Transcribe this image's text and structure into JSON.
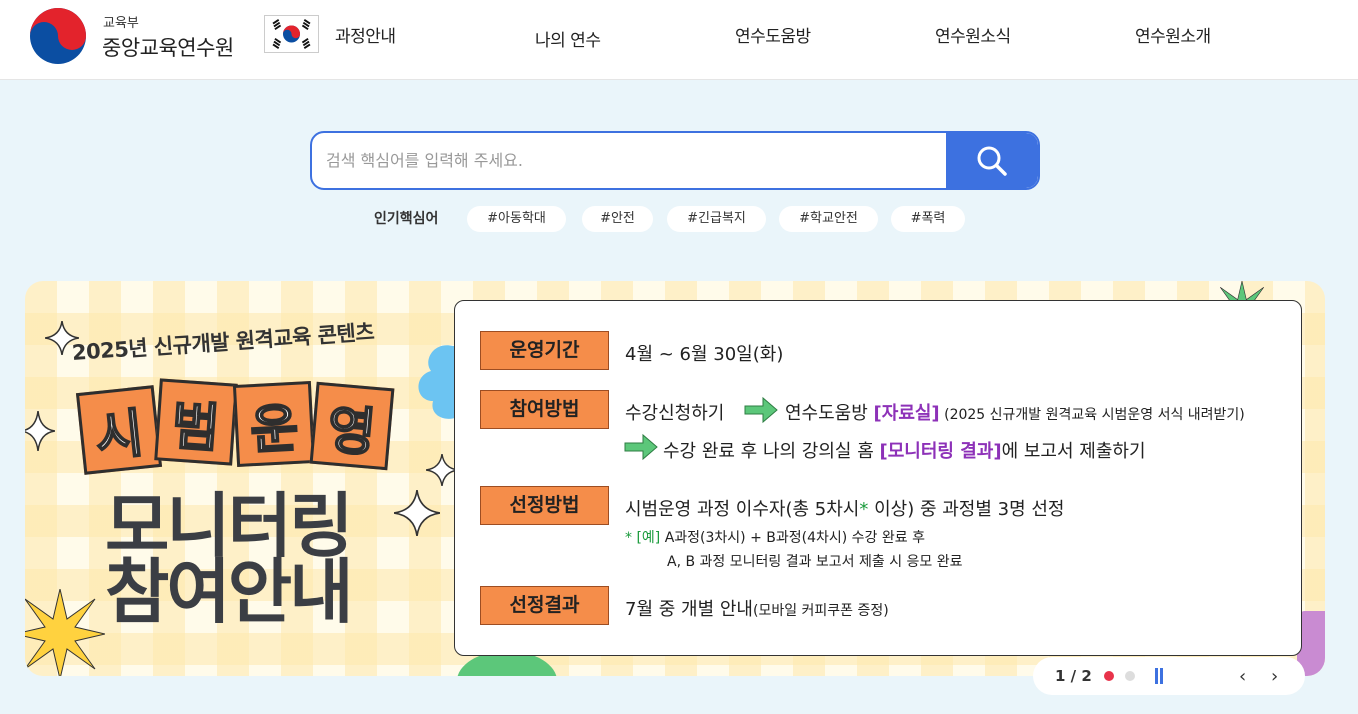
{
  "header": {
    "logo_sub": "교육부",
    "logo_main": "중앙교육연수원",
    "nav": [
      "과정안내",
      "나의 연수",
      "연수도움방",
      "연수원소식",
      "연수원소개"
    ]
  },
  "search": {
    "placeholder": "검색 핵심어를 입력해 주세요.",
    "popular_label": "인기핵심어",
    "tags": [
      "#아동학대",
      "#안전",
      "#긴급복지",
      "#학교안전",
      "#폭력"
    ]
  },
  "banner": {
    "subtitle": "2025년 신규개발 원격교육 콘텐츠",
    "tiles": [
      "시",
      "범",
      "운",
      "영"
    ],
    "title_line1": "모니터링",
    "title_line2": "참여안내",
    "rows": {
      "period_label": "운영기간",
      "period_text": "4월 ~ 6월 30일(화)",
      "method_label": "참여방법",
      "method_a": "수강신청하기",
      "method_b1": "연수도움방 ",
      "method_b2": "[자료실]",
      "method_b3": " (2025 신규개발 원격교육 시범운영 서식 내려받기)",
      "method_c1": "수강 완료 후 나의 강의실 홈 ",
      "method_c2": "[모니터링 결과]",
      "method_c3": "에 보고서 제출하기",
      "select_label": "선정방법",
      "select_text1": "시범운영 과정 이수자(총 5차시",
      "select_star": "*",
      "select_text2": " 이상) 중 과정별 3명 선정",
      "note_prefix": "* [예]",
      "note_line1": " A과정(3차시) + B과정(4차시) 수강 완료 후",
      "note_line2": "A, B 과정 모니터링 결과 보고서 제출 시 응모 완료",
      "result_label": "선정결과",
      "result_text1": "7월 중 개별 안내",
      "result_text2": "(모바일 커피쿠폰 증정)"
    }
  },
  "pager": {
    "count": "1 / 2",
    "prev": "‹",
    "next": "›"
  },
  "colors": {
    "accent": "#3d71e0",
    "orange": "#f58d4a",
    "purple": "#8d31b8",
    "dot_active": "#e8334a"
  }
}
